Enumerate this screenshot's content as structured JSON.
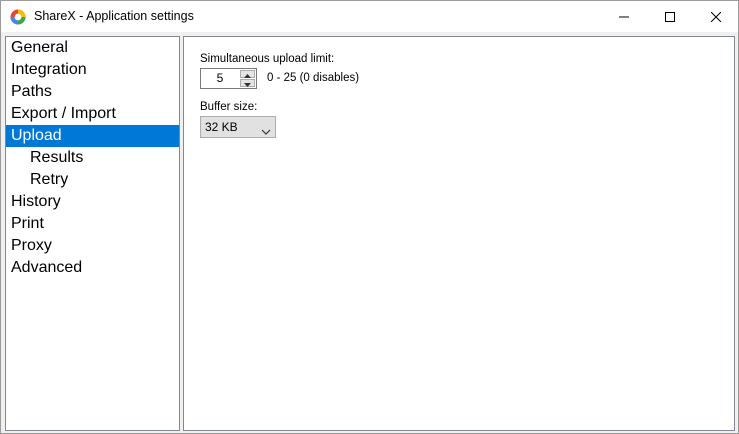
{
  "window": {
    "title": "ShareX - Application settings"
  },
  "nav": {
    "items": [
      {
        "label": "General",
        "level": 0,
        "selected": false
      },
      {
        "label": "Integration",
        "level": 0,
        "selected": false
      },
      {
        "label": "Paths",
        "level": 0,
        "selected": false
      },
      {
        "label": "Export / Import",
        "level": 0,
        "selected": false
      },
      {
        "label": "Upload",
        "level": 0,
        "selected": true
      },
      {
        "label": "Results",
        "level": 1,
        "selected": false
      },
      {
        "label": "Retry",
        "level": 1,
        "selected": false
      },
      {
        "label": "History",
        "level": 0,
        "selected": false
      },
      {
        "label": "Print",
        "level": 0,
        "selected": false
      },
      {
        "label": "Proxy",
        "level": 0,
        "selected": false
      },
      {
        "label": "Advanced",
        "level": 0,
        "selected": false
      }
    ]
  },
  "upload": {
    "simultaneous_label": "Simultaneous upload limit:",
    "simultaneous_value": "5",
    "simultaneous_hint": "0 - 25 (0 disables)",
    "buffer_label": "Buffer size:",
    "buffer_value": "32 KB"
  },
  "colors": {
    "selection": "#0078d7",
    "border": "#828790"
  },
  "icons": {
    "app": "sharex-logo-icon",
    "minimize": "minimize-icon",
    "maximize": "maximize-icon",
    "close": "close-icon",
    "spin_up": "chevron-up-icon",
    "spin_down": "chevron-down-icon",
    "dropdown": "chevron-down-icon"
  }
}
